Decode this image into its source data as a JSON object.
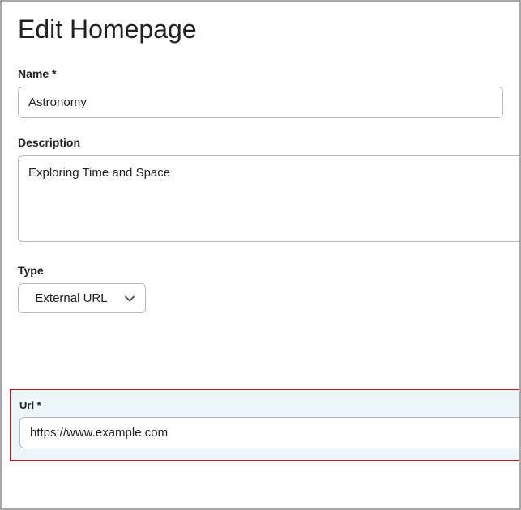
{
  "page": {
    "title": "Edit Homepage"
  },
  "form": {
    "name": {
      "label": "Name *",
      "value": "Astronomy"
    },
    "description": {
      "label": "Description",
      "value": "Exploring Time and Space"
    },
    "type": {
      "label": "Type",
      "selected": "External URL"
    },
    "url": {
      "label": "Url *",
      "value": "https://www.example.com"
    }
  }
}
